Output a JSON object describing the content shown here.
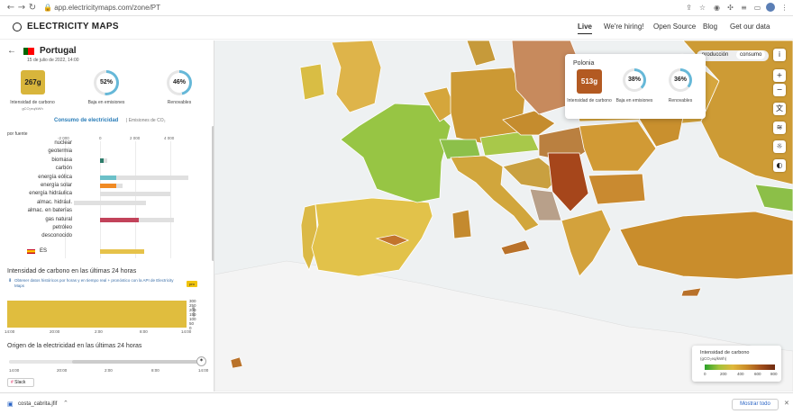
{
  "browser": {
    "url": "app.electricitymaps.com/zone/PT"
  },
  "header": {
    "logo_text": "ELECTRICITY MAPS",
    "nav": [
      "Live",
      "We're hiring!",
      "Open Source",
      "Blog",
      "Get our data"
    ]
  },
  "panel": {
    "country": "Portugal",
    "date": "15 de julio de 2022, 14:00",
    "carbon_intensity": {
      "value": "267g",
      "label": "Intensidad de carbono",
      "unit": "gCO₂eq/kWh"
    },
    "low_emissions": {
      "value": "52%",
      "label": "Baja en emisiones",
      "fraction": 0.52
    },
    "renewables": {
      "value": "46%",
      "label": "Renovables",
      "fraction": 0.46
    },
    "consumption_title": "Consumo de electricidad",
    "consumption_sub": "| Emisiones de CO₂",
    "by_fuel": "por fuente",
    "ticks": [
      "-2 000",
      "0",
      "2 000",
      "4 000"
    ],
    "fuels": [
      {
        "label": "nuclear",
        "bg": 0,
        "fg": 0,
        "color": "#aaa"
      },
      {
        "label": "geotermia",
        "bg": 0,
        "fg": 0,
        "color": "#aaa"
      },
      {
        "label": "biomasa",
        "bg": 400,
        "fg": 230,
        "color": "#2e7d6b"
      },
      {
        "label": "carbón",
        "bg": 0,
        "fg": 0,
        "color": "#aaa"
      },
      {
        "label": "energía eólica",
        "bg": 5000,
        "fg": 900,
        "color": "#6bc0c8"
      },
      {
        "label": "energía solar",
        "bg": 1300,
        "fg": 900,
        "color": "#f08a24"
      },
      {
        "label": "energía hidráulica",
        "bg": 4000,
        "fg": 0,
        "color": "#2a6fb8"
      },
      {
        "label": "almac. hidrául.",
        "bg": 2600,
        "fg": 0,
        "color": "#2a6fb8",
        "neg": 1500
      },
      {
        "label": "almac. en baterías",
        "bg": 0,
        "fg": 0,
        "color": "#aaa"
      },
      {
        "label": "gas natural",
        "bg": 4200,
        "fg": 2200,
        "color": "#c2435a"
      },
      {
        "label": "petróleo",
        "bg": 0,
        "fg": 0,
        "color": "#aaa"
      },
      {
        "label": "desconocido",
        "bg": 0,
        "fg": 0,
        "color": "#aaa"
      }
    ],
    "exchange": {
      "label": "ES",
      "value": 2500,
      "color": "#e6c24a"
    },
    "ci24_title": "Intensidad de carbono en las últimas 24 horas",
    "ci24_link": "Obtener datos históricos por horas y en tiempo real + pronóstico con la API de Electricity Maps",
    "pro_badge": "pro",
    "ci24_yticks": [
      "300",
      "250",
      "200",
      "150",
      "100",
      "50",
      "0"
    ],
    "ci24_yunit": "g/kWh",
    "ci24_xticks": [
      "14:00",
      "20:00",
      "2:00",
      "8:00",
      "14:00"
    ],
    "origin_title": "Origen de la electricidad en las últimas 24 horas",
    "slider_ticks": [
      "14:00",
      "20:00",
      "2:00",
      "8:00",
      "14:00"
    ],
    "slack_label": "Slack"
  },
  "map": {
    "toggle": [
      "producción",
      "consumo"
    ],
    "tooltip": {
      "country": "Polonia",
      "carbon_intensity": "513g",
      "ci_label": "Intensidad de carbono",
      "low_emissions": {
        "value": "38%",
        "label": "Baja en emisiones",
        "fraction": 0.38
      },
      "renewables": {
        "value": "36%",
        "label": "Renovables",
        "fraction": 0.36
      }
    },
    "legend": {
      "title": "Intensidad de carbono",
      "unit": "(gCO₂eq/kWh)",
      "ticks": [
        "0",
        "200",
        "400",
        "600",
        "800"
      ]
    }
  },
  "download": {
    "file": "costa_cabrita.jfif",
    "show_all": "Mostrar todo"
  }
}
